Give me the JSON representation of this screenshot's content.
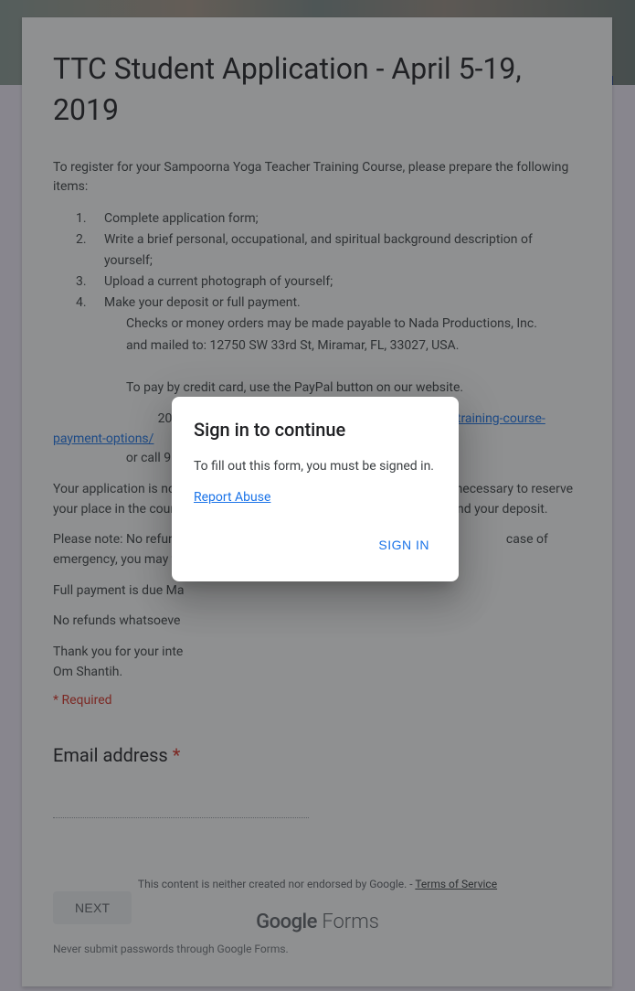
{
  "form": {
    "title": "TTC Student Application - April 5-19, 2019",
    "intro": "To register for your Sampoorna Yoga Teacher Training Course, please prepare the following items:",
    "steps": [
      "Complete application form;",
      "Write a brief personal, occupational, and spiritual background description of yourself;",
      "Upload a current photograph of yourself;",
      "Make your deposit or full payment."
    ],
    "step4_sub1": "Checks or money orders may be made payable to Nada Productions, Inc.",
    "step4_sub2": "and mailed to: 12750 SW 33rd St, Miramar, FL, 33027, USA.",
    "pay_cc_line": "To pay by credit card, use the PayPal button on our website.",
    "pay_200_prefix": "200-hour: ",
    "pay_200_link_text": "www.yogihari.com/200-hour-yoga-teacher-training-course-payment-options/",
    "call_line": "or call 954-399-8000.",
    "not_complete": "Your application is not complete until we receive your deposit, which is necessary to reserve your place in the course. If your application is not approved, we will refund your deposit.",
    "please_note": "Please note: No refund",
    "please_note_tail": "case of emergency, you may transfer your c",
    "full_payment": "Full payment is due Ma",
    "no_refunds": "No refunds whatsoeve",
    "thanks": "Thank you for your inte",
    "om": "Om Shantih.",
    "required_note": "* Required",
    "question": {
      "label": "Email address",
      "required": "*"
    },
    "next": "NEXT",
    "pw_disclaimer": "Never submit passwords through Google Forms."
  },
  "footer": {
    "line_prefix": "This content is neither created nor endorsed by Google. - ",
    "tos": "Terms of Service",
    "logo_google": "Google",
    "logo_forms": " Forms"
  },
  "dialog": {
    "title": "Sign in to continue",
    "body": "To fill out this form, you must be signed in.",
    "report": "Report Abuse",
    "signin": "SIGN IN"
  }
}
